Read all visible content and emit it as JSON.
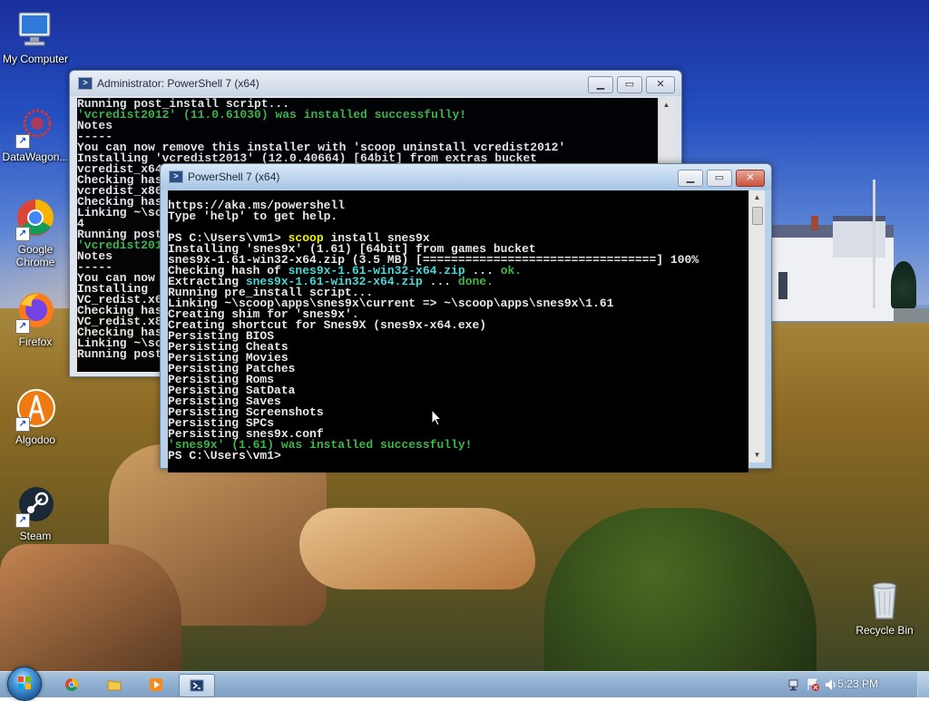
{
  "desktop": {
    "icons": [
      {
        "label": "My Computer"
      },
      {
        "label": "DataWagon..."
      },
      {
        "label": "Google Chrome"
      },
      {
        "label": "Firefox"
      },
      {
        "label": "Algodoo"
      },
      {
        "label": "Steam"
      },
      {
        "label": "Recycle Bin"
      }
    ]
  },
  "back_window": {
    "title": "Administrator: PowerShell 7 (x64)",
    "lines": [
      {
        "t": "Running post_install script...",
        "c": ""
      },
      {
        "t": "'vcredist2012' (11.0.61030) was installed successfully!",
        "c": "green"
      },
      {
        "t": "Notes",
        "c": ""
      },
      {
        "t": "-----",
        "c": ""
      },
      {
        "t": "You can now remove this installer with 'scoop uninstall vcredist2012'",
        "c": ""
      },
      {
        "t": "Installing 'vcredist2013' (12.0.40664) [64bit] from extras bucket",
        "c": ""
      },
      {
        "t": "vcredist_x64",
        "c": ""
      },
      {
        "t": "Checking has",
        "c": ""
      },
      {
        "t": "vcredist_x86",
        "c": ""
      },
      {
        "t": "Checking has",
        "c": ""
      },
      {
        "t": "Linking ~\\sc",
        "c": ""
      },
      {
        "t": "4",
        "c": ""
      },
      {
        "t": "Running post",
        "c": ""
      },
      {
        "t": "'vcredist201",
        "c": "green"
      },
      {
        "t": "Notes",
        "c": ""
      },
      {
        "t": "-----",
        "c": ""
      },
      {
        "t": "You can now",
        "c": ""
      },
      {
        "t": "Installing",
        "c": ""
      },
      {
        "t": "VC_redist.x6",
        "c": ""
      },
      {
        "t": "Checking has",
        "c": ""
      },
      {
        "t": "VC_redist.x8",
        "c": ""
      },
      {
        "t": "Checking has",
        "c": ""
      },
      {
        "t": "Linking ~\\sc",
        "c": ""
      },
      {
        "t": "Running post",
        "c": ""
      }
    ]
  },
  "front_window": {
    "title": "PowerShell 7 (x64)",
    "lines": [
      [
        {
          "t": "https://aka.ms/powershell",
          "c": ""
        }
      ],
      [
        {
          "t": "Type 'help' to get help.",
          "c": ""
        }
      ],
      [
        {
          "t": "",
          "c": ""
        }
      ],
      [
        {
          "t": "PS C:\\Users\\vm1> ",
          "c": ""
        },
        {
          "t": "scoop",
          "c": "yellow"
        },
        {
          "t": " install snes9x",
          "c": ""
        }
      ],
      [
        {
          "t": "Installing 'snes9x' (1.61) [64bit] from games bucket",
          "c": ""
        }
      ],
      [
        {
          "t": "snes9x-1.61-win32-x64.zip (3.5 MB) [=================================] 100%",
          "c": ""
        }
      ],
      [
        {
          "t": "Checking hash of ",
          "c": ""
        },
        {
          "t": "snes9x-1.61-win32-x64.zip",
          "c": "cyan"
        },
        {
          "t": " ... ",
          "c": ""
        },
        {
          "t": "ok.",
          "c": "green"
        }
      ],
      [
        {
          "t": "Extracting ",
          "c": ""
        },
        {
          "t": "snes9x-1.61-win32-x64.zip",
          "c": "cyan"
        },
        {
          "t": " ... ",
          "c": ""
        },
        {
          "t": "done.",
          "c": "green"
        }
      ],
      [
        {
          "t": "Running pre_install script...",
          "c": ""
        }
      ],
      [
        {
          "t": "Linking ~\\scoop\\apps\\snes9x\\current => ~\\scoop\\apps\\snes9x\\1.61",
          "c": ""
        }
      ],
      [
        {
          "t": "Creating shim for 'snes9x'.",
          "c": ""
        }
      ],
      [
        {
          "t": "Creating shortcut for Snes9X (snes9x-x64.exe)",
          "c": ""
        }
      ],
      [
        {
          "t": "Persisting BIOS",
          "c": ""
        }
      ],
      [
        {
          "t": "Persisting Cheats",
          "c": ""
        }
      ],
      [
        {
          "t": "Persisting Movies",
          "c": ""
        }
      ],
      [
        {
          "t": "Persisting Patches",
          "c": ""
        }
      ],
      [
        {
          "t": "Persisting Roms",
          "c": ""
        }
      ],
      [
        {
          "t": "Persisting SatData",
          "c": ""
        }
      ],
      [
        {
          "t": "Persisting Saves",
          "c": ""
        }
      ],
      [
        {
          "t": "Persisting Screenshots",
          "c": ""
        }
      ],
      [
        {
          "t": "Persisting SPCs",
          "c": ""
        }
      ],
      [
        {
          "t": "Persisting snes9x.conf",
          "c": ""
        }
      ],
      [
        {
          "t": "'snes9x' (1.61) was installed successfully!",
          "c": "green"
        }
      ],
      [
        {
          "t": "PS C:\\Users\\vm1>",
          "c": ""
        }
      ]
    ]
  },
  "taskbar": {
    "clock": "5:23 PM"
  },
  "colors": {
    "console_bg": "#000000",
    "success_green": "#3fb54a",
    "command_yellow": "#f2f000",
    "path_cyan": "#4ad7d7",
    "close_red": "#c9523c"
  }
}
